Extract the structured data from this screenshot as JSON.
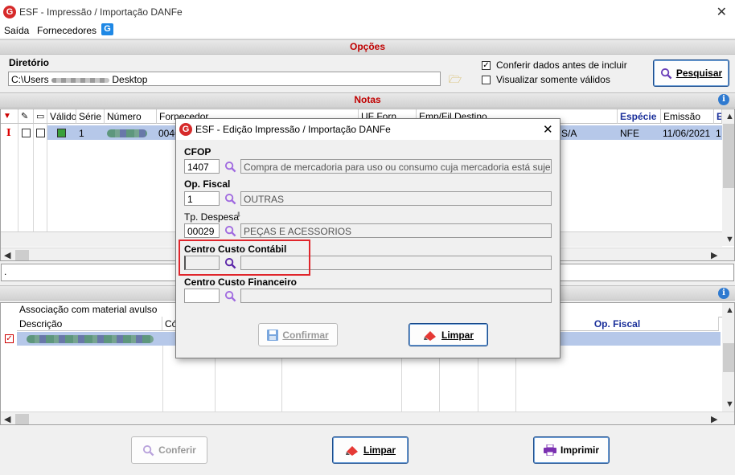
{
  "window": {
    "title": "ESF - Impressão / Importação DANFe",
    "close": "✕"
  },
  "menu": {
    "items": [
      "Saída",
      "Fornecedores"
    ]
  },
  "opcoes": {
    "section_title": "Opções",
    "directory_label": "Diretório",
    "directory_prefix": "C:\\Users",
    "directory_suffix": "Desktop",
    "check_confirm": "Conferir dados antes de incluir",
    "check_confirm_checked": "✓",
    "check_valid_only": "Visualizar somente válidos",
    "search_label": "Pesquisar"
  },
  "notas": {
    "section_title": "Notas",
    "headers": [
      "Válido",
      "Série",
      "Número",
      "Fornecedor",
      "UF Forn.",
      "Emp/Fil Destino",
      "Espécie",
      "Emissão",
      "E"
    ],
    "row": {
      "marker": "I",
      "serie": "1",
      "fornecedor_partial": "0046",
      "emp_partial": "S/A",
      "especie": "NFE",
      "emissao": "11/06/2021",
      "extra": "1"
    }
  },
  "status_text": ".",
  "assoc": {
    "title": "Associação com material avulso",
    "headers": [
      "Descrição",
      "Có",
      "Op. Fiscal"
    ],
    "row_checked": "✓"
  },
  "bottom_buttons": {
    "conferir": "Conferir",
    "limpar": "Limpar",
    "imprimir": "Imprimir"
  },
  "dialog": {
    "title": "ESF - Edição Impressão / Importação DANFe",
    "close": "✕",
    "cfop_label": "CFOP",
    "cfop_code": "1407",
    "cfop_desc": "Compra de mercadoria para uso ou consumo cuja mercadoria está sujeita ao regi",
    "opfiscal_label": "Op. Fiscal",
    "opfiscal_code": "1",
    "opfiscal_desc": "OUTRAS",
    "tpdespesa_label": "Tp. Despesa",
    "tpdespesa_code": "00029",
    "tpdespesa_desc": "PEÇAS E ACESSORIOS",
    "cc_contabil_label": "Centro Custo Contábil",
    "cc_contabil_code": "",
    "cc_contabil_desc": "",
    "cc_financeiro_label": "Centro Custo Financeiro",
    "cc_financeiro_code": "",
    "cc_financeiro_desc": "",
    "confirmar_label": "Confirmar",
    "limpar_label": "Limpar"
  },
  "colors": {
    "section_title": "#c00000",
    "selected_row": "#b6c8e9",
    "highlight_box": "#e0252b",
    "header_blue": "#1a2f9a"
  }
}
